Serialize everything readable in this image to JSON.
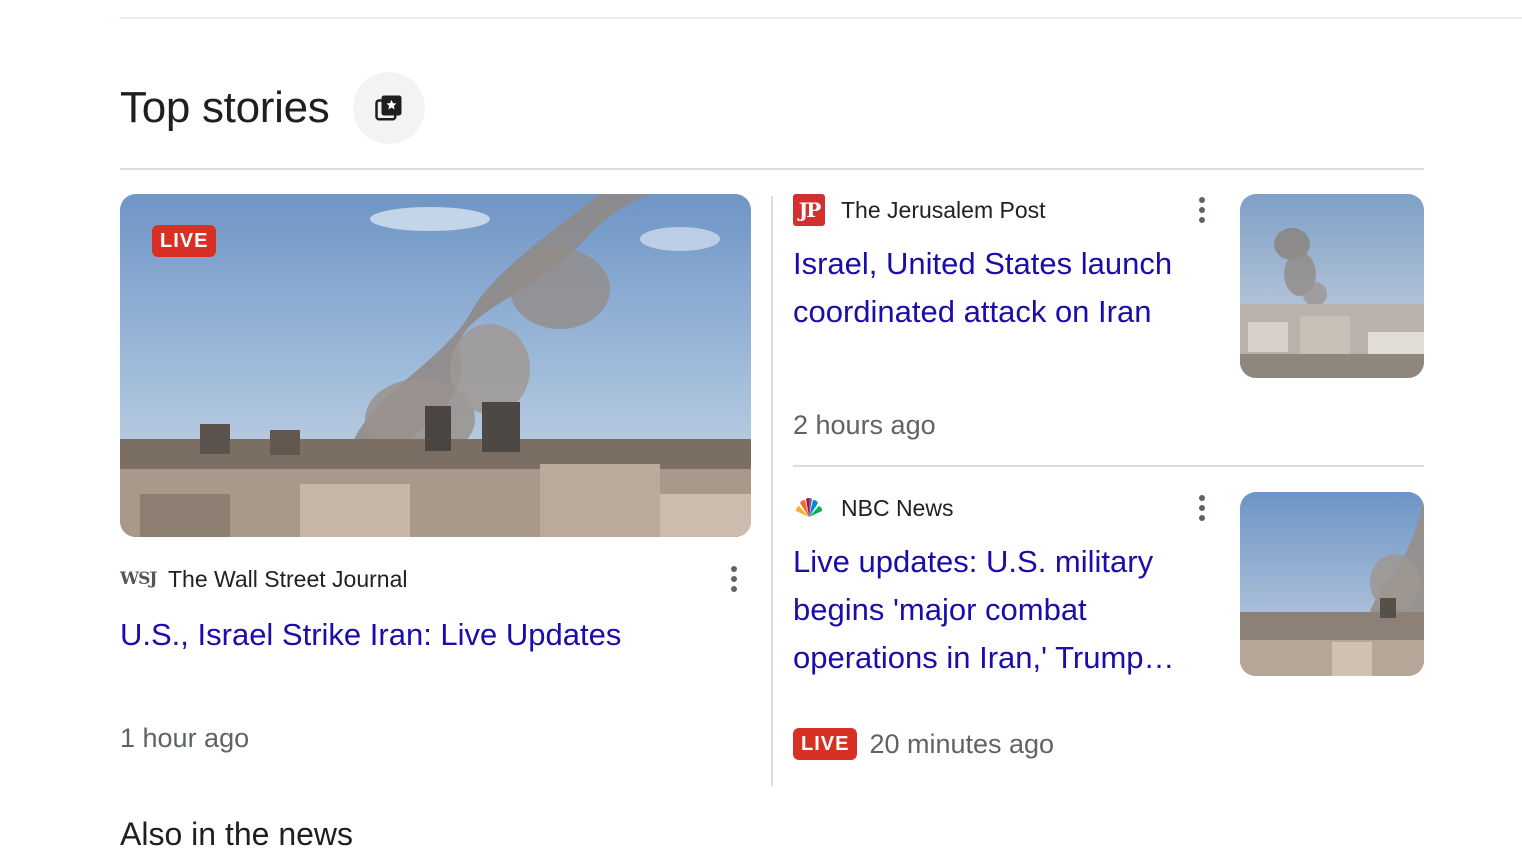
{
  "section": {
    "title": "Top stories",
    "more_button_icon": "stacked-cards-star-icon",
    "next_section_title": "Also in the news"
  },
  "stories": [
    {
      "source": "The Wall Street Journal",
      "source_logo_text": "WSJ",
      "headline": "U.S., Israel Strike Iran: Live Updates",
      "time": "1 hour ago",
      "live_label": "LIVE"
    },
    {
      "source": "The Jerusalem Post",
      "source_logo_text": "JP",
      "headline_line1": "Israel, United States launch",
      "headline_line2": "coordinated attack on Iran",
      "time": "2 hours ago"
    },
    {
      "source": "NBC News",
      "headline_line1": "Live updates: U.S. military",
      "headline_line2": "begins 'major combat",
      "headline_line3": "operations in Iran,' Trump…",
      "time": "20 minutes ago",
      "live_label": "LIVE"
    }
  ],
  "colors": {
    "link": "#1a0dab",
    "live_badge": "#d93025",
    "meta_text": "#5f6368",
    "divider": "#dadce0"
  }
}
